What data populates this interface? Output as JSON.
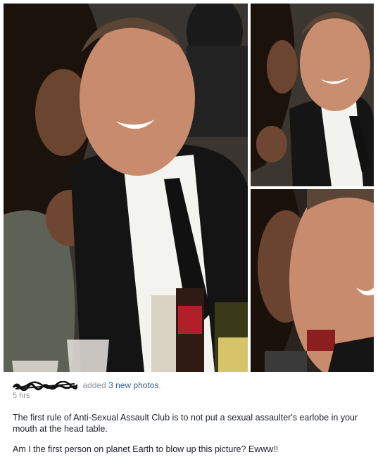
{
  "post": {
    "author": "",
    "action": "added",
    "photo_count_link": "3 new photos",
    "timestamp": "5 hrs",
    "paragraphs": [
      "The first rule of Anti-Sexual Assault Club is to not put a sexual assaulter's earlobe in your mouth at the head table.",
      "Am I the first person on planet Earth to blow up this picture? Ewww!!"
    ]
  },
  "colors": {
    "link": "#365899",
    "meta_gray": "#90949c",
    "body_text": "#1d2129"
  }
}
